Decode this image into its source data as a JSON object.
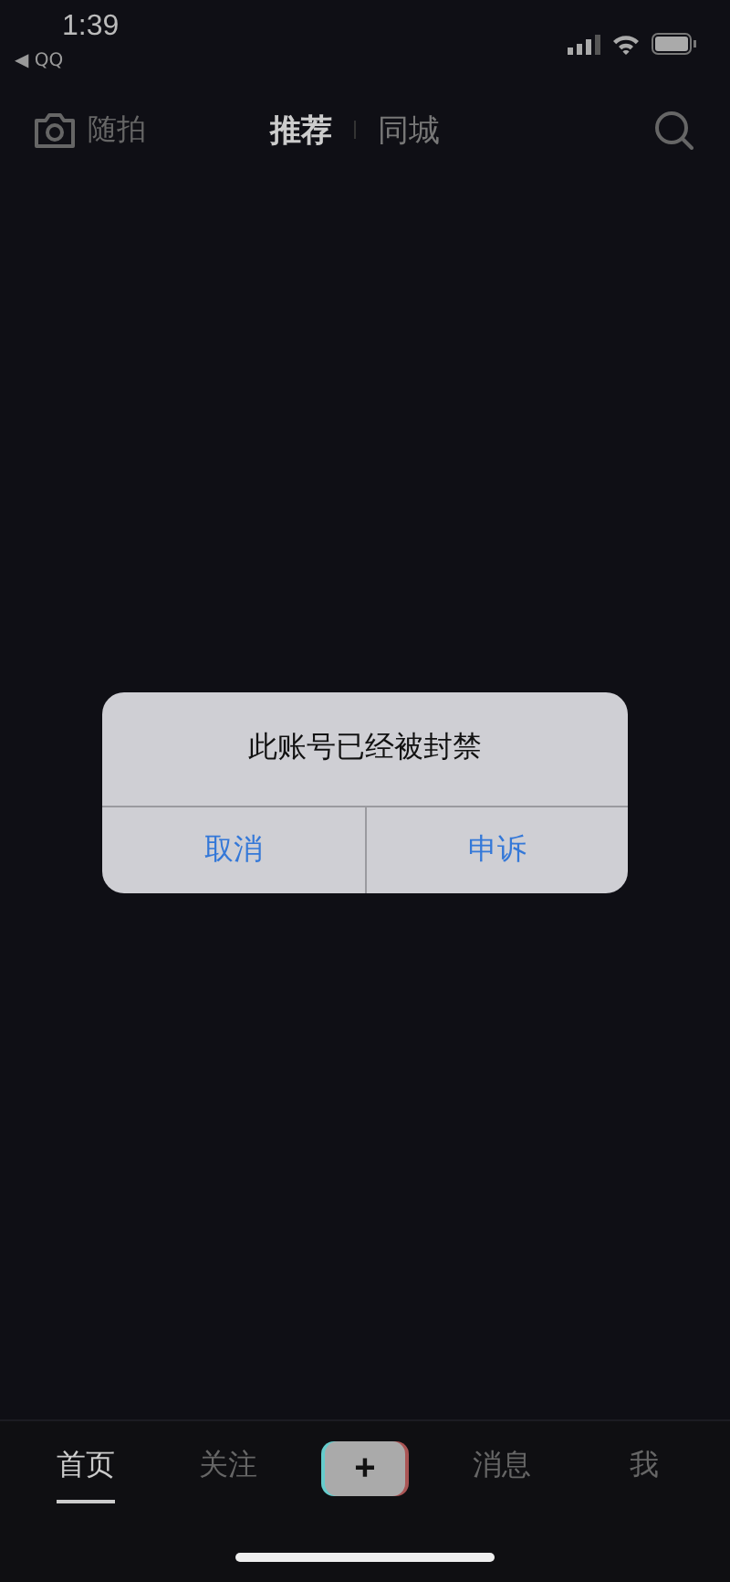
{
  "status_bar": {
    "time": "1:39",
    "back_app": "◀ QQ"
  },
  "top_nav": {
    "camera_label": "随拍",
    "tabs": [
      {
        "label": "推荐",
        "selected": true
      },
      {
        "label": "同城",
        "selected": false
      }
    ]
  },
  "dialog": {
    "message": "此账号已经被封禁",
    "buttons": [
      "取消",
      "申诉"
    ]
  },
  "bottom_nav": {
    "tabs": [
      {
        "kind": "tab",
        "label": "首页",
        "selected": true
      },
      {
        "kind": "tab",
        "label": "关注",
        "selected": false
      },
      {
        "kind": "create",
        "label": "+",
        "selected": false
      },
      {
        "kind": "tab",
        "label": "消息",
        "selected": false
      },
      {
        "kind": "tab",
        "label": "我",
        "selected": false
      }
    ]
  }
}
